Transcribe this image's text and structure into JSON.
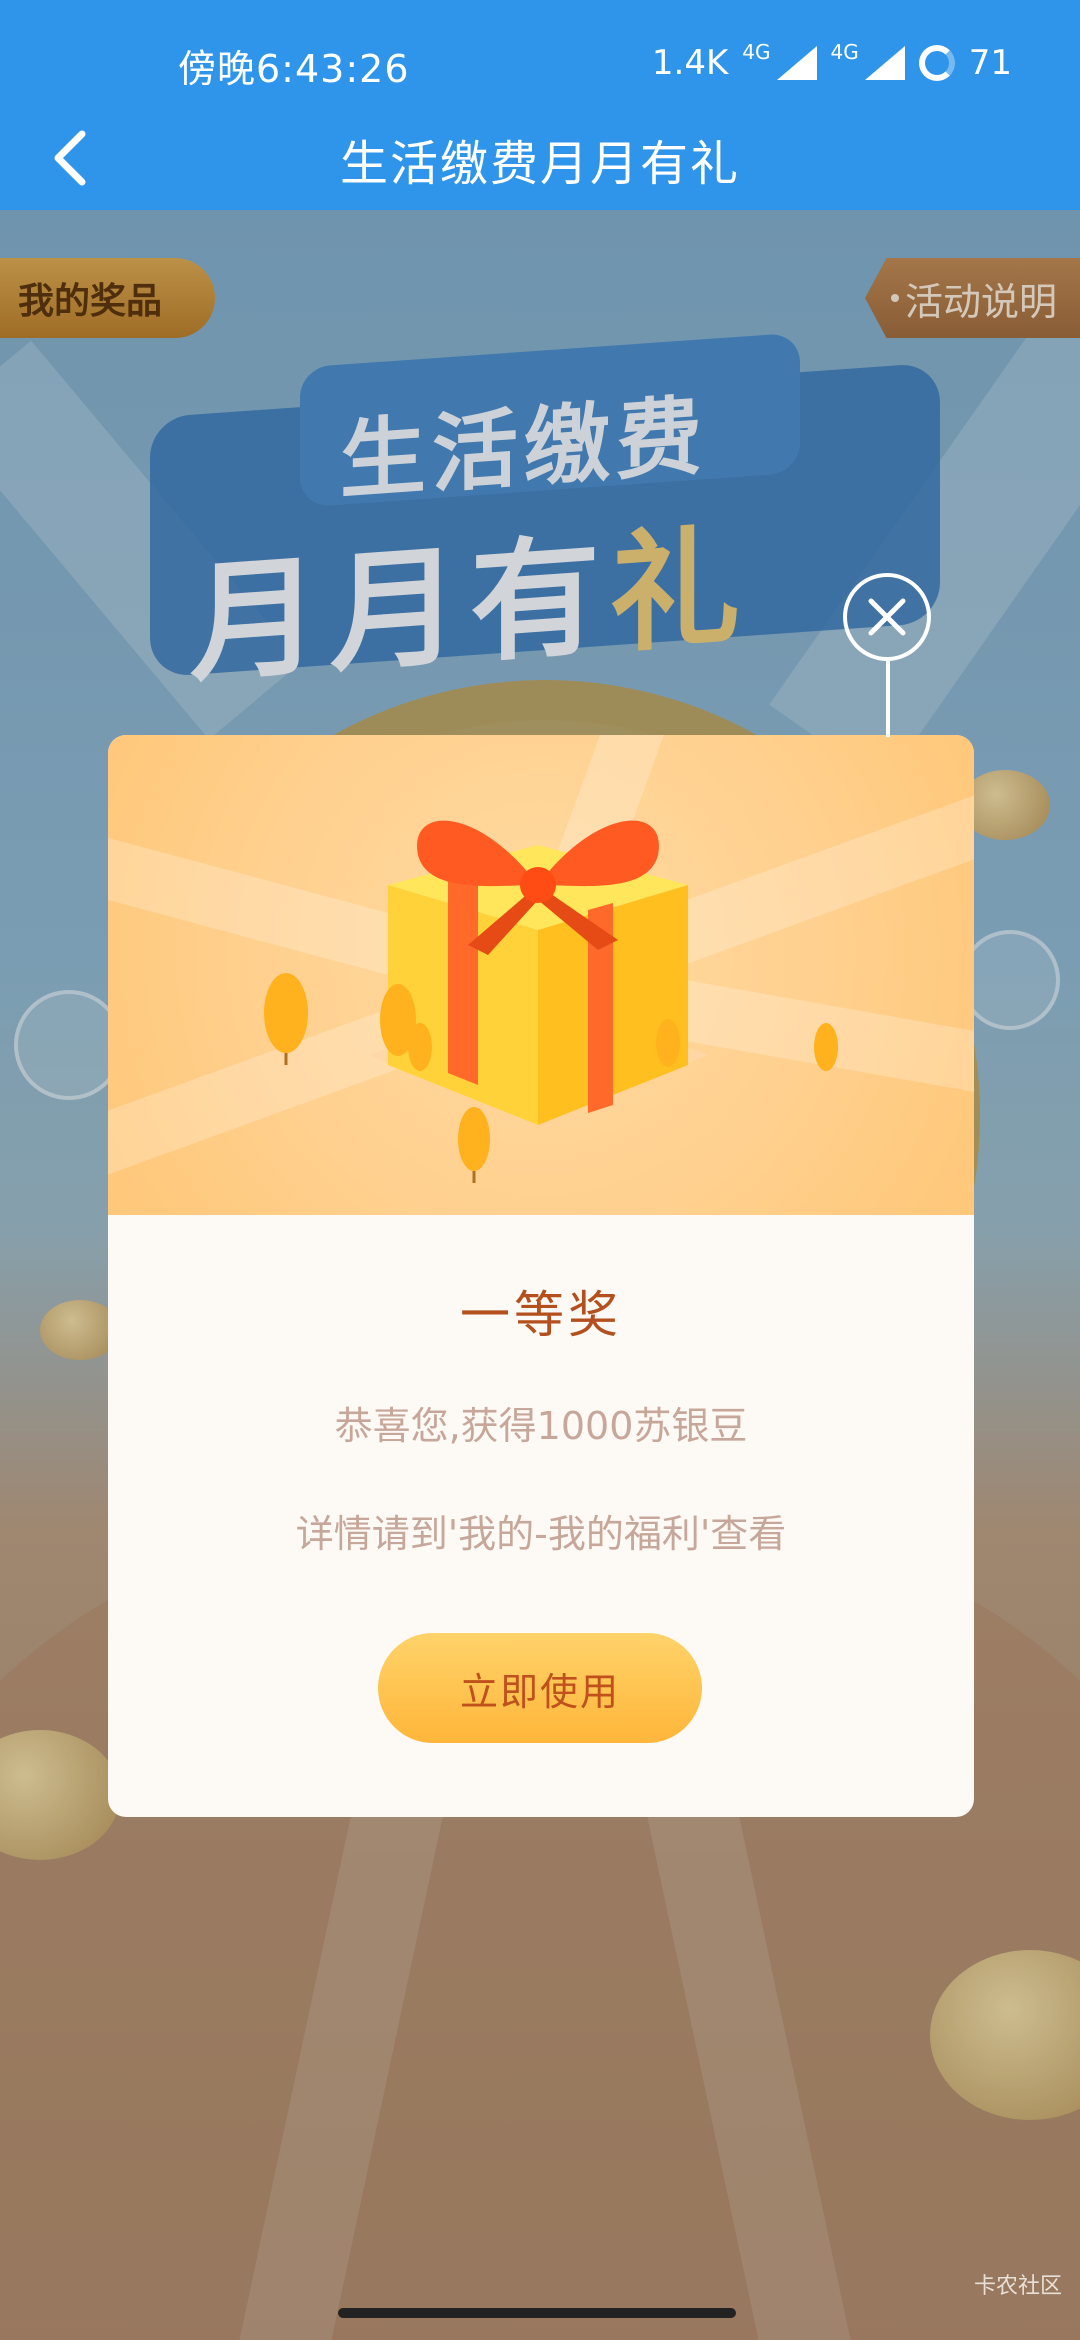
{
  "status_bar": {
    "time": "傍晚6:43:26",
    "speed": "1.4K",
    "net1": "4G",
    "net2": "4G",
    "battery": "71"
  },
  "nav": {
    "title": "生活缴费月月有礼"
  },
  "page": {
    "my_prizes_label": "我的奖品",
    "rules_label": "活动说明",
    "banner_line1": "生活缴费",
    "banner_line2_a": "月月有",
    "banner_line2_b": "礼"
  },
  "modal": {
    "title": "一等奖",
    "line1": "恭喜您,获得1000苏银豆",
    "line2": "详情请到'我的-我的福利'查看",
    "button_label": "立即使用"
  },
  "watermark": "卡农社区",
  "colors": {
    "header": "#2f95ea",
    "accent": "#ffb63a",
    "title": "#b3501e"
  }
}
